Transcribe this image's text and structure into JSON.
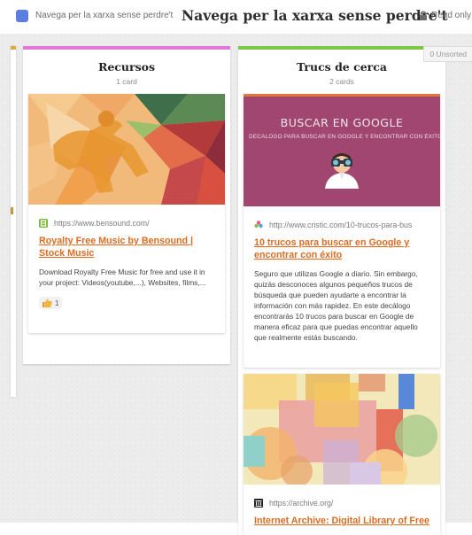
{
  "header": {
    "breadcrumb": "Navega per la xarxa sense perdre't",
    "title": "Navega per la xarxa sense perdre't",
    "readonly": "Read only",
    "accent": "#5b7fe0"
  },
  "columns": [
    {
      "title": "Recursos",
      "count": "1 card",
      "color": "#e07ad6",
      "cards": [
        {
          "url": "https://www.bensound.com/",
          "title": "Royalty Free Music by Bensound | Stock Music",
          "description": "Download Royalty Free Music for free and use it in your project: Videos(youtube,...), Websites, films,...",
          "reaction_icon": "thumbs-up-icon",
          "reaction_count": "1"
        }
      ]
    },
    {
      "title": "Trucs de cerca",
      "count": "2 cards",
      "color": "#7ac843",
      "cards": [
        {
          "image_heading": "BUSCAR EN GOOGLE",
          "image_subheading": "DECÁLOGO PARA BUSCAR EN GOOGLE Y ENCONTRAR CON ÉXITO",
          "url": "http://www.cristic.com/10-trucos-para-bus",
          "title": "10 trucos para buscar en Google y encontrar con éxito",
          "description": "Seguro que utilizas Google a diario. Sin embargo, quizás desconoces algunos pequeños trucos de búsqueda que pueden ayudarte a encontrar la información con más rapidez. En este decálogo encontrarás 10 trucos para buscar en Google de manera eficaz para que puedas encontrar aquello que realmente estás buscando."
        },
        {
          "url": "https://archive.org/",
          "title": "Internet Archive: Digital Library of Free"
        }
      ]
    }
  ],
  "unsorted_label": "0 Unsorted"
}
